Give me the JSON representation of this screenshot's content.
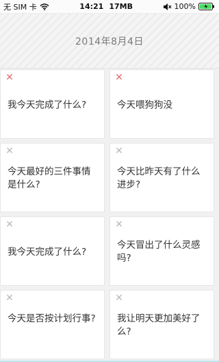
{
  "status_bar": {
    "carrier": "无 SIM 卡",
    "time": "14:21",
    "memory": "17MB",
    "battery_percent": "100%"
  },
  "header": {
    "date": "2014年8月4日"
  },
  "cards": [
    {
      "close": "✕",
      "text": "我今天完成了什么?"
    },
    {
      "close": "✕",
      "text": "今天喂狗狗没"
    },
    {
      "close": "✕",
      "text": "今天最好的三件事情是什么?"
    },
    {
      "close": "✕",
      "text": "今天比昨天有了什么进步?"
    },
    {
      "close": "✕",
      "text": "我今天完成了什么?"
    },
    {
      "close": "✕",
      "text": "今天冒出了什么灵感吗?"
    },
    {
      "close": "✕",
      "text": "今天是否按计划行事?"
    },
    {
      "close": "✕",
      "text": "我让明天更加美好了么?"
    }
  ],
  "colors": {
    "close_active": "#e86b6b",
    "close_inactive": "#b9b9b9",
    "battery_green": "#4cd964"
  },
  "icons": {
    "wifi": "wifi-icon",
    "mute": "mute-icon",
    "battery": "battery-icon",
    "close": "close-icon"
  }
}
